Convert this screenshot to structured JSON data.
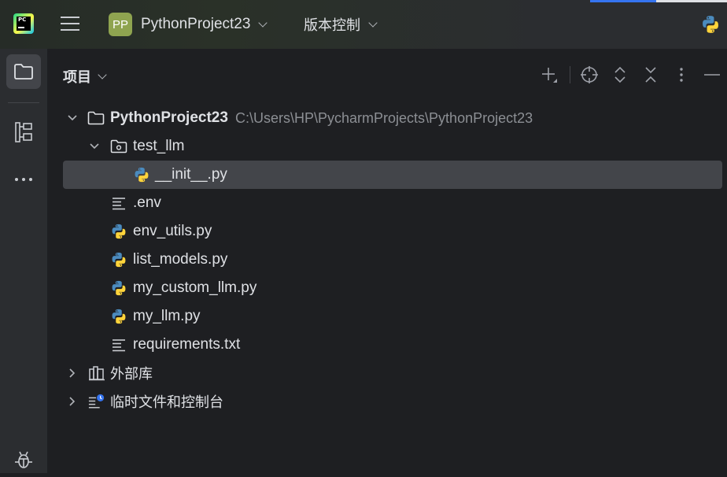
{
  "topbar": {
    "app_logo_text": "PC",
    "project_badge": "PP",
    "project_name": "PythonProject23",
    "vcs_label": "版本控制"
  },
  "panel": {
    "title": "项目"
  },
  "tree": {
    "root_name": "PythonProject23",
    "root_path": "C:\\Users\\HP\\PycharmProjects\\PythonProject23",
    "items": [
      {
        "label": "test_llm"
      },
      {
        "label": "__init__.py"
      },
      {
        "label": ".env"
      },
      {
        "label": "env_utils.py"
      },
      {
        "label": "list_models.py"
      },
      {
        "label": "my_custom_llm.py"
      },
      {
        "label": "my_llm.py"
      },
      {
        "label": "requirements.txt"
      },
      {
        "label": "外部库"
      },
      {
        "label": "临时文件和控制台"
      }
    ]
  },
  "colors": {
    "background": "#1e1f22",
    "sidebar": "#2b2d30",
    "selection": "#43454a",
    "badge": "#8fa450",
    "python_blue": "#4b8bbe",
    "python_yellow": "#ffd43b",
    "path_gray": "#8c8f94"
  }
}
